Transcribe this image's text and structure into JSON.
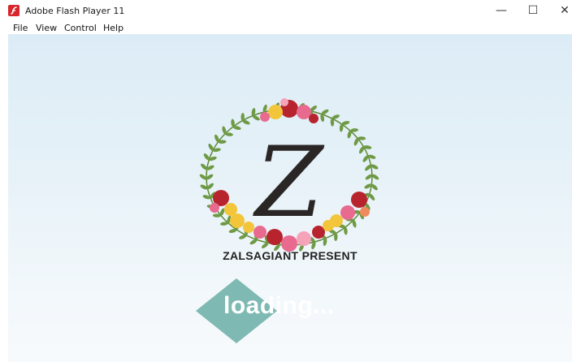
{
  "window": {
    "title": "Adobe Flash Player 11",
    "minimize_glyph": "—",
    "maximize_glyph": "☐",
    "close_glyph": "✕",
    "app_icon": "flash-player-icon"
  },
  "menu": {
    "items": [
      {
        "label": "File"
      },
      {
        "label": "View"
      },
      {
        "label": "Control"
      },
      {
        "label": "Help"
      }
    ]
  },
  "content": {
    "present_text": "ZALSAGIANT PRESENT",
    "loading_text": "loading...",
    "monogram_letter": "Z",
    "colors": {
      "stage_top": "#dcecf6",
      "diamond": "#7fb9b3",
      "leaf": "#6f9a45",
      "rose_red": "#b8242e",
      "rose_pink": "#e86a8f",
      "rose_yellow": "#f2c53b",
      "flash_red": "#d8262c"
    }
  }
}
